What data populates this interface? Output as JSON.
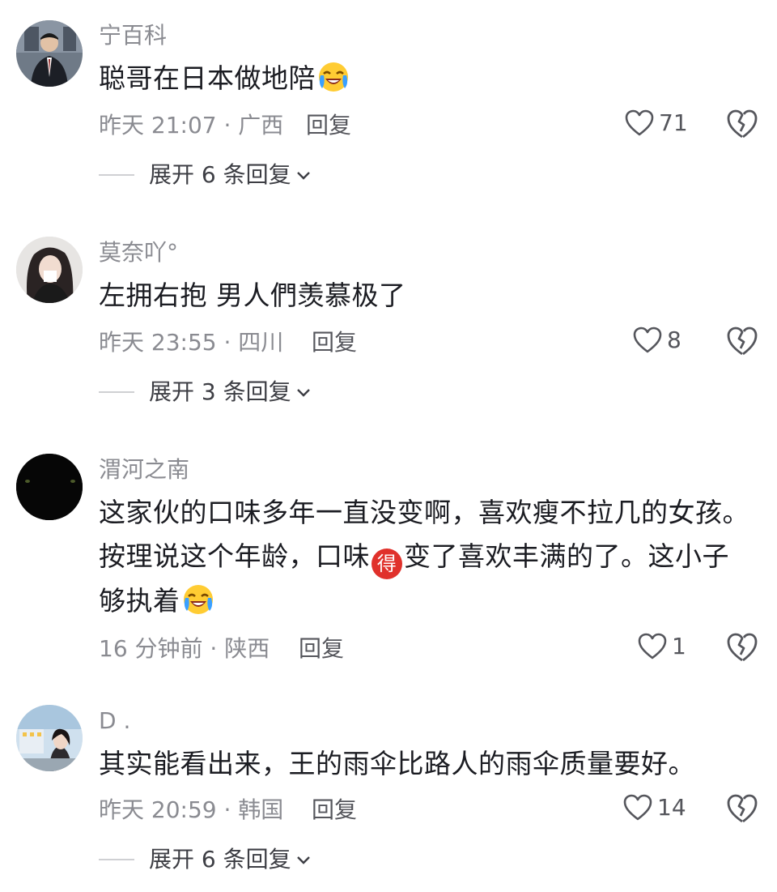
{
  "comments": [
    {
      "username": "宁百科",
      "text": "聪哥在日本做地陪",
      "emoji": "laugh-cry-emoji",
      "meta": "昨天 21:07 · 广西",
      "reply": "回复",
      "likes": "71",
      "expand": "展开 6 条回复"
    },
    {
      "username": "莫奈吖°",
      "text": "左拥右抱 男人們羡慕极了",
      "meta": "昨天 23:55 · 四川",
      "reply": "回复",
      "likes": "8",
      "expand": "展开 3 条回复"
    },
    {
      "username": "渭河之南",
      "line1": "这家伙的口味多年一直没变啊，喜欢瘦不拉几的女孩。",
      "line2a": "按理说这个年龄，口味",
      "badge": "得",
      "line2b": "变了喜欢丰满的了。这小子",
      "line3": "够执着",
      "emoji": "laugh-cry-emoji",
      "meta": "16 分钟前 · 陕西",
      "reply": "回复",
      "likes": "1"
    },
    {
      "username": "D  .",
      "text": "其实能看出来，王的雨伞比路人的雨伞质量要好。",
      "meta": "昨天 20:59 · 韩国",
      "reply": "回复",
      "likes": "14",
      "expand": "展开 6 条回复"
    }
  ],
  "colors": {
    "text": "#1b1c22",
    "muted": "#8a8b91",
    "action": "#55565c",
    "badge": "#e0312b"
  }
}
